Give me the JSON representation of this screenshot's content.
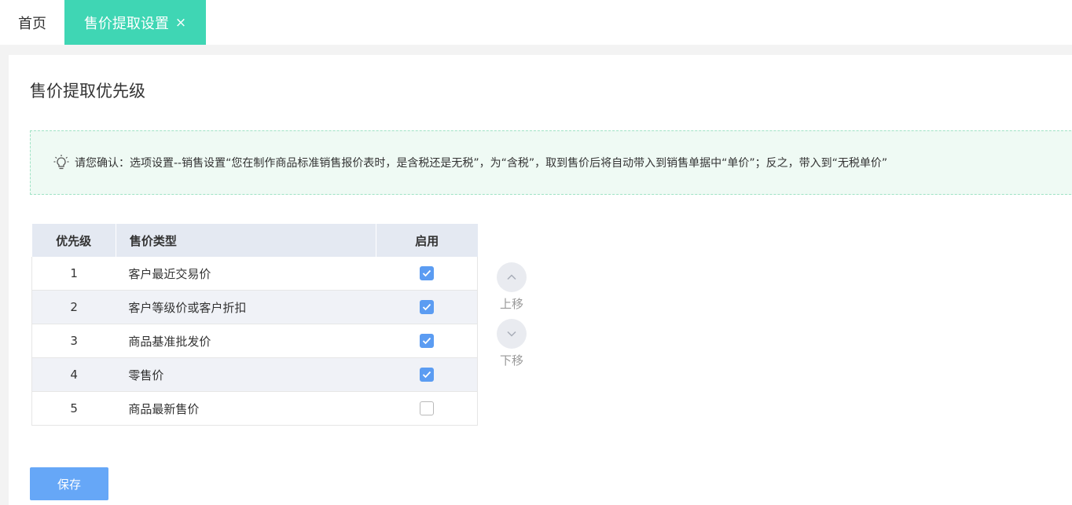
{
  "tabs": [
    {
      "label": "首页",
      "active": false
    },
    {
      "label": "售价提取设置",
      "active": true,
      "close_glyph": "×"
    }
  ],
  "page": {
    "title": "售价提取优先级",
    "notice_icon": "lightbulb-icon",
    "notice": "请您确认：选项设置--销售设置“您在制作商品标准销售报价表时，是含税还是无税”，为“含税”，取到售价后将自动带入到销售单据中“单价”；反之，带入到“无税单价”"
  },
  "table": {
    "headers": [
      "优先级",
      "售价类型",
      "启用"
    ],
    "rows": [
      {
        "priority": "1",
        "type": "客户最近交易价",
        "enabled": true
      },
      {
        "priority": "2",
        "type": "客户等级价或客户折扣",
        "enabled": true
      },
      {
        "priority": "3",
        "type": "商品基准批发价",
        "enabled": true
      },
      {
        "priority": "4",
        "type": "零售价",
        "enabled": true
      },
      {
        "priority": "5",
        "type": "商品最新售价",
        "enabled": false
      }
    ]
  },
  "move": {
    "up_label": "上移",
    "down_label": "下移",
    "up_icon": "chevron-up-icon",
    "down_icon": "chevron-down-icon"
  },
  "save_label": "保存",
  "colors": {
    "active_tab": "#3fd6b4",
    "checkbox": "#5b9cf2",
    "save_button": "#66a7f7",
    "notice_bg": "#effaf4",
    "notice_border": "#9fe3c5",
    "header_bg": "#e4e9f2"
  }
}
